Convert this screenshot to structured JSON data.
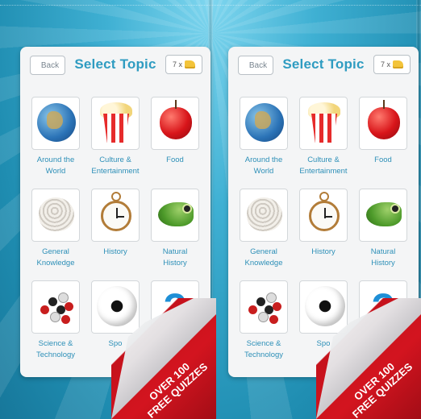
{
  "screens": [
    {
      "header": {
        "back_label": "Back",
        "title": "Select Topic",
        "credits": "7 x"
      },
      "topics": [
        {
          "label": "Around the\nWorld",
          "icon": "globe-icon"
        },
        {
          "label": "Culture &\nEntertainment",
          "icon": "popcorn-icon"
        },
        {
          "label": "Food",
          "icon": "apple-icon"
        },
        {
          "label": "General\nKnowledge",
          "icon": "brain-icon"
        },
        {
          "label": "History",
          "icon": "pocket-watch-icon"
        },
        {
          "label": "Natural\nHistory",
          "icon": "frog-icon"
        },
        {
          "label": "Science &\nTechnology",
          "icon": "molecule-icon"
        },
        {
          "label": "Spo",
          "icon": "soccer-ball-icon"
        },
        {
          "label": "",
          "icon": "question-mark-icon"
        }
      ]
    },
    {
      "header": {
        "back_label": "Back",
        "title": "Select Topic",
        "credits": "7 x"
      },
      "topics": [
        {
          "label": "Around the\nWorld",
          "icon": "globe-icon"
        },
        {
          "label": "Culture &\nEntertainment",
          "icon": "popcorn-icon"
        },
        {
          "label": "Food",
          "icon": "apple-icon"
        },
        {
          "label": "General\nKnowledge",
          "icon": "brain-icon"
        },
        {
          "label": "History",
          "icon": "pocket-watch-icon"
        },
        {
          "label": "Natural\nHistory",
          "icon": "frog-icon"
        },
        {
          "label": "Science &\nTechnology",
          "icon": "molecule-icon"
        },
        {
          "label": "Spo",
          "icon": "soccer-ball-icon"
        },
        {
          "label": "",
          "icon": "question-mark-icon"
        }
      ]
    }
  ],
  "promo": {
    "text": "OVER 100\nFREE QUIZZES"
  },
  "question_glyph": "?",
  "colors": {
    "accent": "#2f9cc1",
    "promo_red": "#c5121c",
    "background": "#2a9dc0"
  }
}
